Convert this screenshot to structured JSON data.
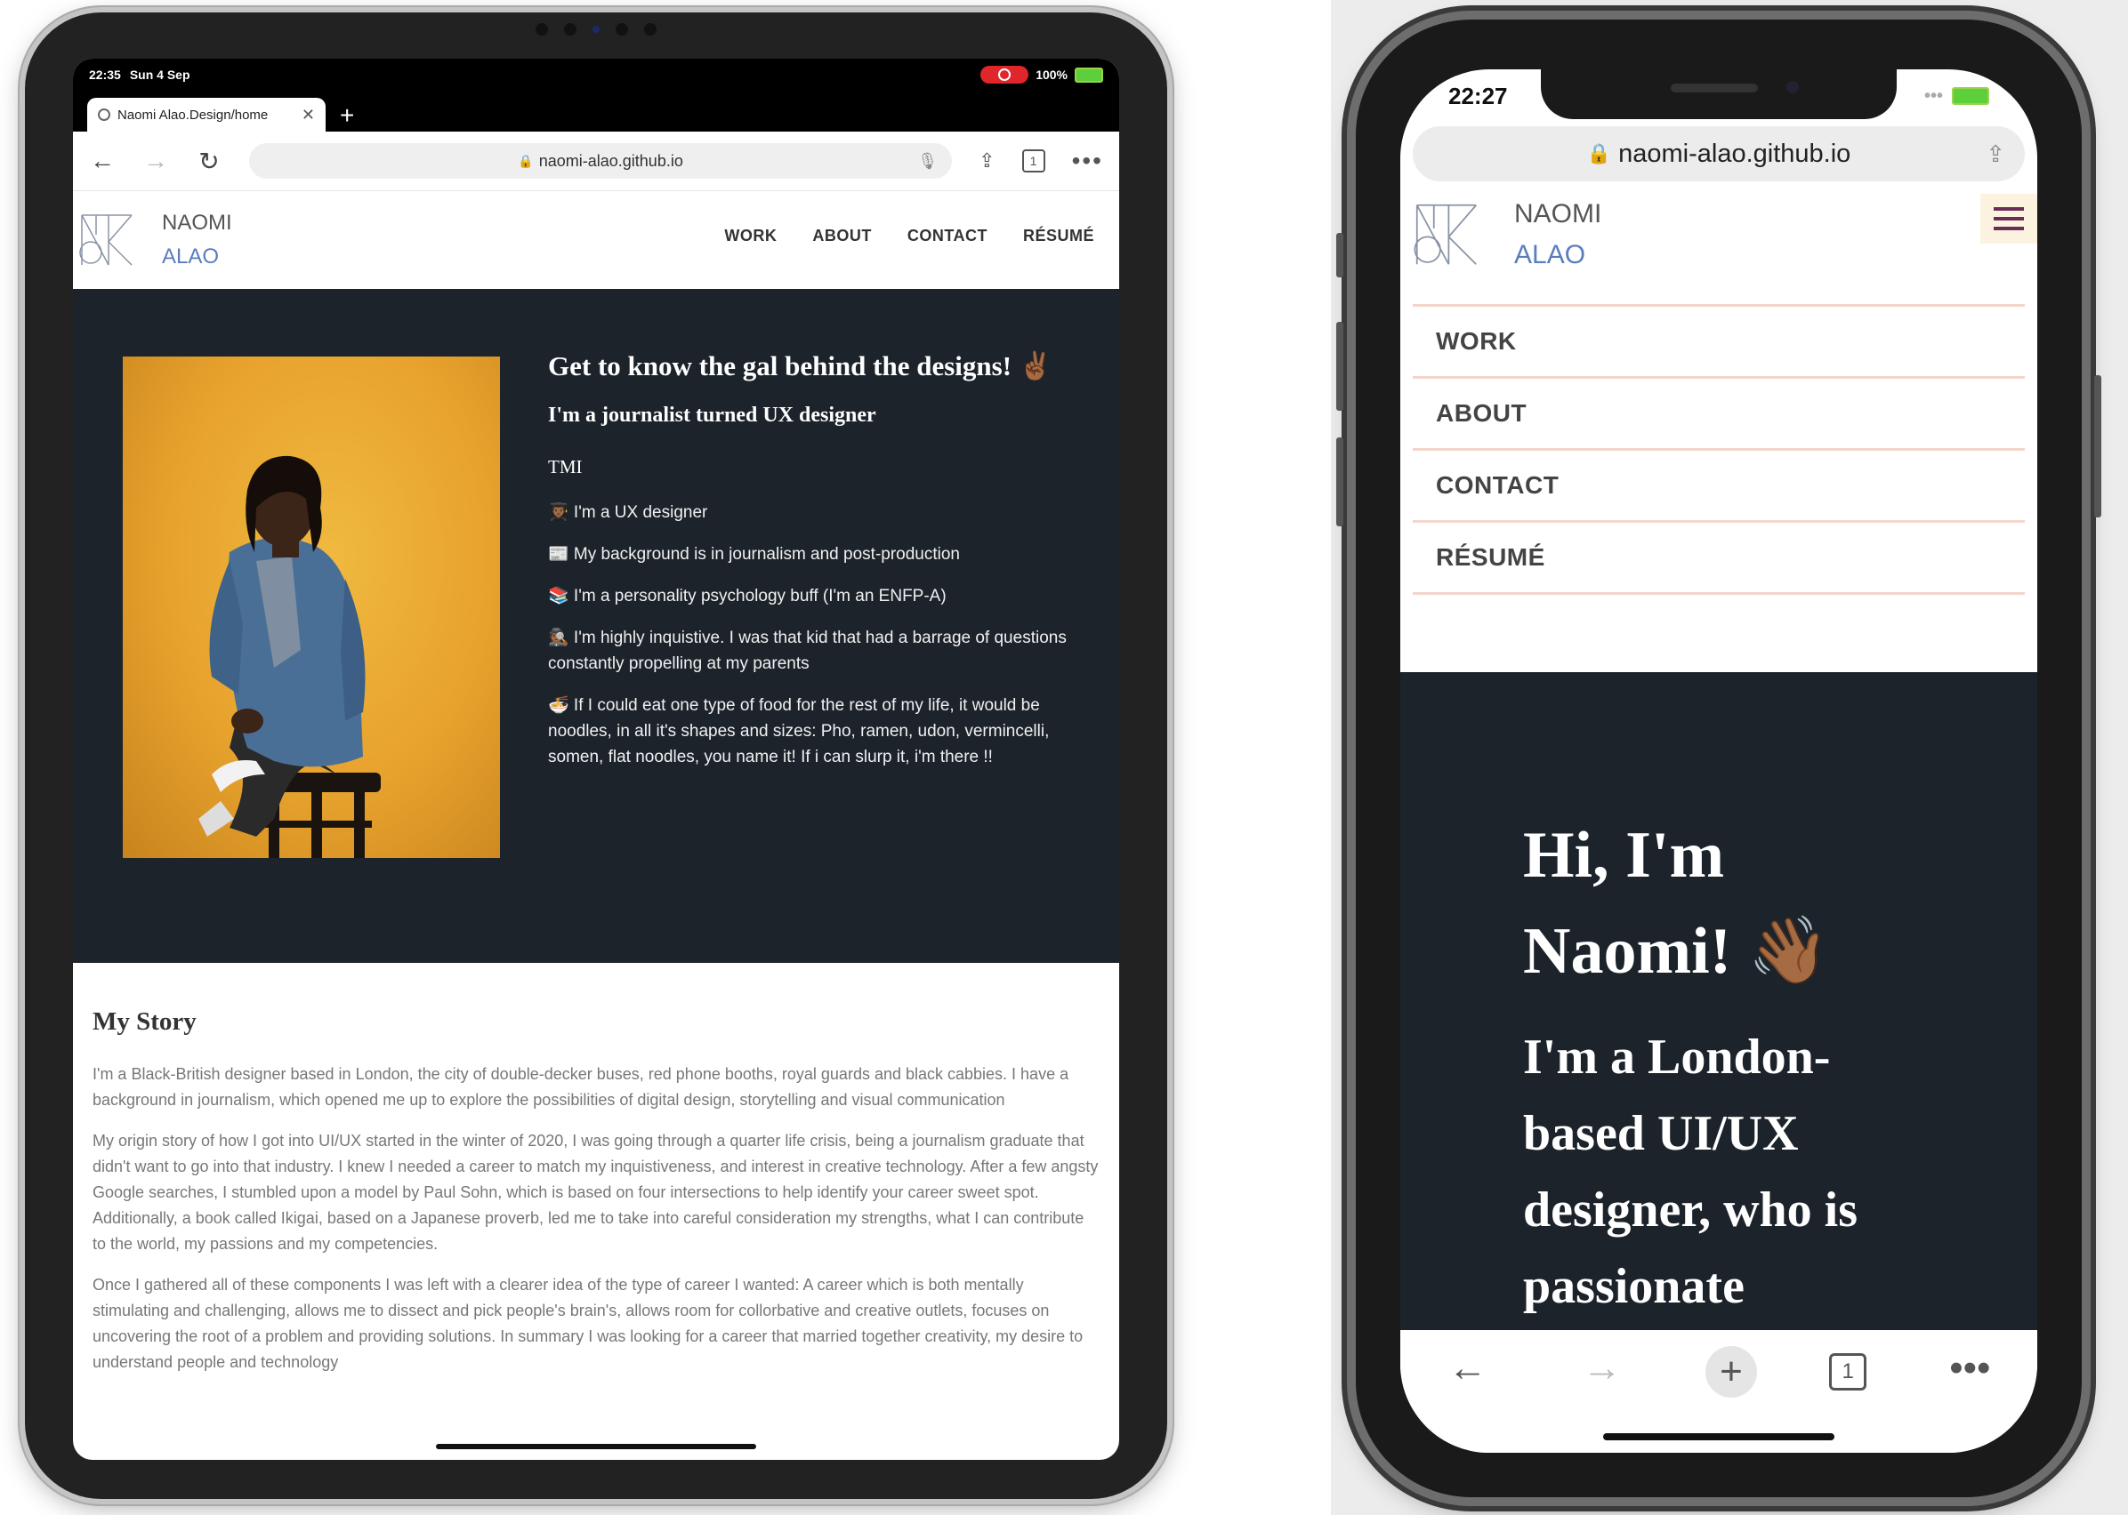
{
  "ipad": {
    "status": {
      "time": "22:35",
      "date": "Sun 4 Sep",
      "battery": "100%"
    },
    "tab": {
      "title": "Naomi Alao.Design/home",
      "close": "✕",
      "new_tab": "+"
    },
    "url": "naomi-alao.github.io",
    "tab_count": "1",
    "header": {
      "first_name": "NAOMI",
      "last_name": "ALAO"
    },
    "nav": [
      "WORK",
      "ABOUT",
      "CONTACT",
      "RÉSUMÉ"
    ],
    "about": {
      "title": "Get to know the gal behind the designs! ✌🏾",
      "subtitle": "I'm a journalist turned UX designer",
      "tmi": "TMI",
      "facts": [
        "👨🏾‍🎓 I'm a UX designer",
        "📰 My background is in journalism and post-production",
        "📚 I'm a personality psychology buff (I'm an ENFP-A)",
        "🕵🏾 I'm highly inquistive. I was that kid that had a barrage of questions constantly propelling at my parents",
        "🍜 If I could eat one type of food for the rest of my life, it would be noodles, in all it's shapes and sizes: Pho, ramen, udon, vermincelli, somen, flat noodles, you name it! If i can slurp it, i'm there !!"
      ]
    },
    "story": {
      "heading": "My Story",
      "paragraphs": [
        "I'm a Black-British designer based in London, the city of double-decker buses, red phone booths, royal guards and black cabbies. I have a background in journalism, which opened me up to explore the possibilities of digital design, storytelling and visual communication",
        "My origin story of how I got into UI/UX started in the winter of 2020, I was going through a quarter life crisis, being a journalism graduate that didn't want to go into that industry. I knew I needed a career to match my inquistiveness, and interest in creative technology. After a few angsty Google searches, I stumbled upon a model by Paul Sohn, which is based on four intersections to help identify your career sweet spot. Additionally, a book called Ikigai, based on a Japanese proverb, led me to take into careful consideration my strengths, what I can contribute to the world, my passions and my competencies.",
        "Once I gathered all of these components I was left with a clearer idea of the type of career I wanted: A career which is both mentally stimulating and challenging, allows me to dissect and pick people's brain's, allows room for collorbative and creative outlets, focuses on uncovering the root of a problem and providing solutions. In summary I was looking for a career that married together creativity, my desire to understand people and technology"
      ]
    }
  },
  "iphone": {
    "status": {
      "time": "22:27"
    },
    "url": "naomi-alao.github.io",
    "header": {
      "first_name": "NAOMI",
      "last_name": "ALAO"
    },
    "menu": [
      "WORK",
      "ABOUT",
      "CONTACT",
      "RÉSUMÉ"
    ],
    "hero": {
      "greeting": "Hi, I'm Naomi! 👋🏾",
      "intro": "I'm a London-based UI/UX designer, who is passionate"
    },
    "tab_count": "1"
  },
  "colors": {
    "dark_section": "#1c232b",
    "brand_blue": "#5a7dbf",
    "menu_divider": "#f4d5cc",
    "photo_bg": "#e7a22d"
  },
  "icons": [
    "back-icon",
    "forward-icon",
    "reload-icon",
    "lock-icon",
    "mic-icon",
    "share-icon",
    "tabs-icon",
    "more-icon",
    "hamburger-icon",
    "plus-icon",
    "globe-icon"
  ]
}
